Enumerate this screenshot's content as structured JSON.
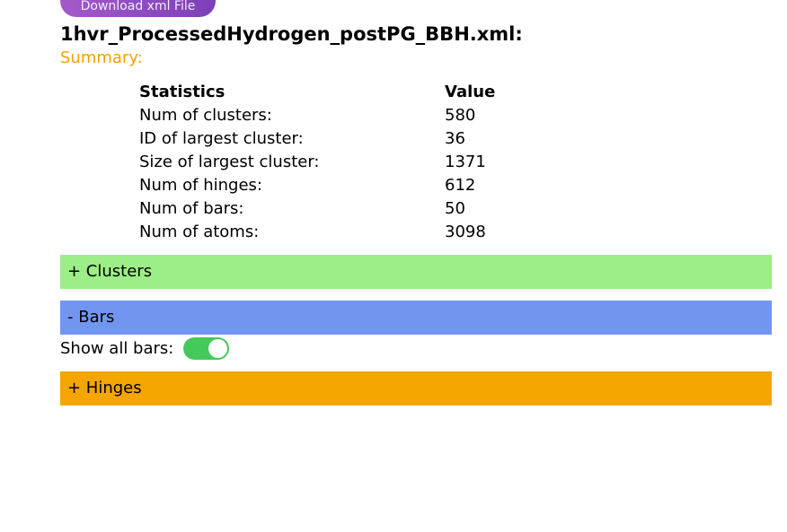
{
  "header": {
    "download_label": "Download xml File",
    "file_title": "1hvr_ProcessedHydrogen_postPG_BBH.xml:",
    "summary_label": "Summary:"
  },
  "stats": {
    "headers": [
      "Statistics",
      "Value"
    ],
    "rows": [
      {
        "label": "Num of clusters:",
        "value": "580"
      },
      {
        "label": "ID of largest cluster:",
        "value": "36"
      },
      {
        "label": "Size of largest cluster:",
        "value": "1371"
      },
      {
        "label": "Num of hinges:",
        "value": "612"
      },
      {
        "label": "Num of bars:",
        "value": "50"
      },
      {
        "label": "Num of atoms:",
        "value": "3098"
      }
    ]
  },
  "sections": {
    "clusters_label": "+ Clusters",
    "bars_label": "- Bars",
    "hinges_label": "+ Hinges"
  },
  "bars": {
    "show_all_label": "Show all bars:",
    "show_all_on": true
  },
  "colors": {
    "summary": "#f0a300",
    "clusters": "#9cee87",
    "bars": "#7296f0",
    "hinges": "#f4a500",
    "toggle_on": "#45c95c",
    "download_button": "#9b4fc4"
  }
}
